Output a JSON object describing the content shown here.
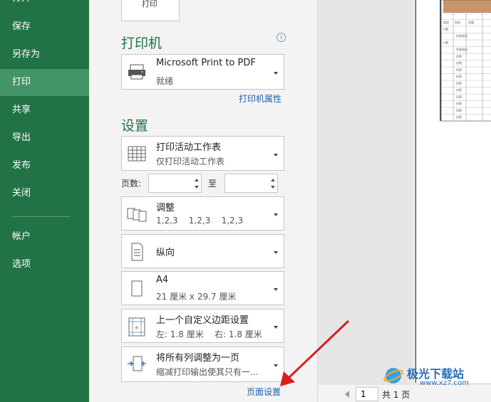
{
  "sidebar": {
    "items": [
      {
        "label": "打开"
      },
      {
        "label": "保存"
      },
      {
        "label": "另存为"
      },
      {
        "label": "打印"
      },
      {
        "label": "共享"
      },
      {
        "label": "导出"
      },
      {
        "label": "发布"
      },
      {
        "label": "关闭"
      },
      {
        "label": "帐户"
      },
      {
        "label": "选项"
      }
    ]
  },
  "print_button_label": "打印",
  "printer": {
    "title": "打印机",
    "info_icon": "info-icon",
    "name": "Microsoft Print to PDF",
    "status": "就绪",
    "properties_link": "打印机属性"
  },
  "settings": {
    "title": "设置",
    "scope": {
      "main": "打印活动工作表",
      "sub": "仅打印活动工作表"
    },
    "pages_label": "页数:",
    "to_label": "至",
    "pages_from": "",
    "pages_to": "",
    "collate": {
      "main": "调整",
      "sub": "1,2,3    1,2,3    1,2,3"
    },
    "orientation": {
      "main": "纵向"
    },
    "paper": {
      "main": "A4",
      "sub": "21 厘米 x 29.7 厘米"
    },
    "margins": {
      "main": "上一个自定义边距设置",
      "sub": "左: 1.8 厘米    右: 1.8 厘米"
    },
    "scaling": {
      "main": "将所有列调整为一页",
      "sub": "缩减打印输出使其只有一..."
    },
    "page_setup_link": "页面设置"
  },
  "preview": {
    "current_page": "1",
    "total_label": "共 1 页",
    "table_labels": [
      "类型",
      "系别",
      "总量",
      "人数",
      "在职党员",
      "人数",
      "共青团员",
      "在职",
      "在职",
      "在职",
      "在职",
      "在职",
      "在职",
      "在职",
      "在职",
      "在职",
      "在职"
    ]
  },
  "watermark": {
    "text": "极光下载站",
    "url": "www.xz7.com"
  },
  "colors": {
    "sidebar": "#217346",
    "active": "#439467",
    "accent": "#217346",
    "link": "#1e5fa8",
    "arrow": "#d42020"
  }
}
